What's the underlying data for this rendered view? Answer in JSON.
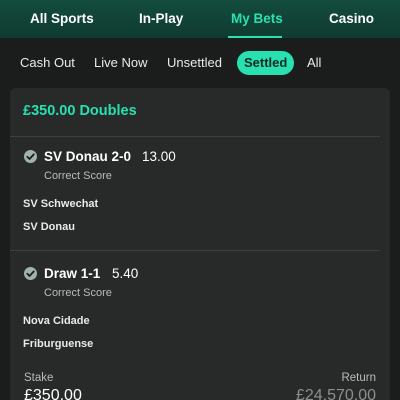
{
  "top_nav": {
    "items": [
      "All Sports",
      "In-Play",
      "My Bets",
      "Casino"
    ],
    "active_index": 2
  },
  "filters": {
    "items": [
      "Cash Out",
      "Live Now",
      "Unsettled",
      "Settled",
      "All"
    ],
    "active_index": 3
  },
  "bet": {
    "title": "£350.00 Doubles",
    "selections": [
      {
        "name": "SV Donau 2-0",
        "odds": "13.00",
        "market": "Correct Score",
        "teams": [
          "SV Schwechat",
          "SV Donau"
        ]
      },
      {
        "name": "Draw 1-1",
        "odds": "5.40",
        "market": "Correct Score",
        "teams": [
          "Nova Cidade",
          "Friburguense"
        ]
      }
    ],
    "stake_label": "Stake",
    "stake_value": "£350.00",
    "return_label": "Return",
    "return_value": "£24,570.00"
  },
  "colors": {
    "accent": "#28e0b0",
    "nav_bg": "#134c3c",
    "card_bg": "#272a29",
    "page_bg": "#1b1d1c"
  },
  "icons": [
    "check-circle-icon"
  ]
}
